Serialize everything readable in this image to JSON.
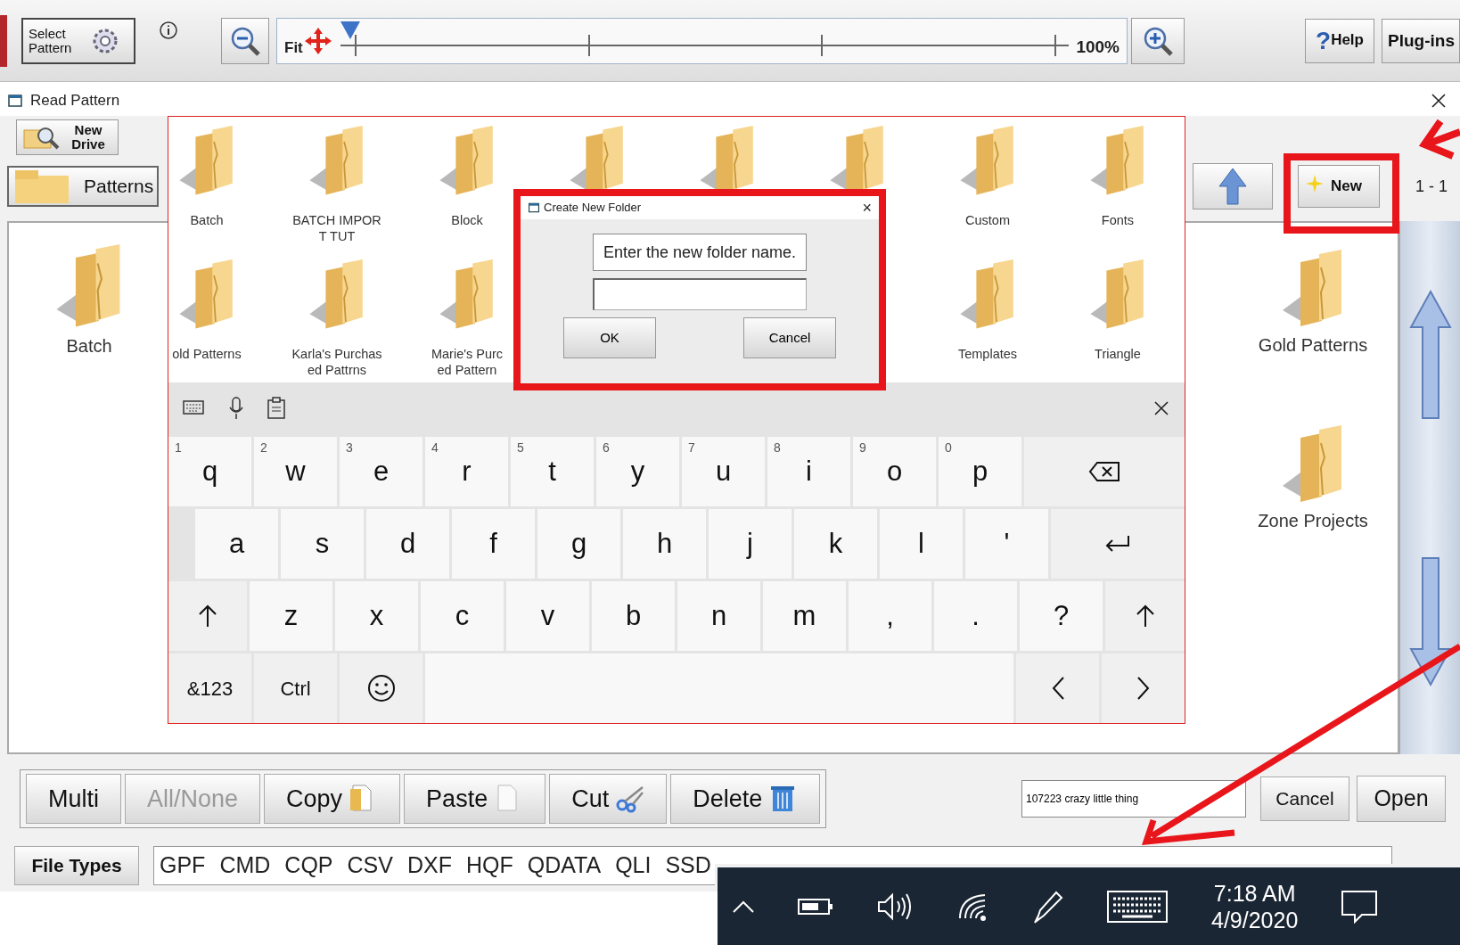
{
  "toolbar": {
    "select_pattern": "Select Pattern",
    "zoom": {
      "fit_label": "Fit",
      "max_label": "100%",
      "level": 0
    },
    "help": {
      "glyph": "?",
      "label": "Help"
    },
    "plugins": "Plug-ins"
  },
  "window": {
    "title": "Read Pattern"
  },
  "drive_button": "New Drive",
  "patterns_button": "Patterns",
  "nav": {
    "new_button": "New",
    "count": "1 - 1"
  },
  "left_folders": [
    {
      "name": "Batch"
    }
  ],
  "right_folders": [
    {
      "name": "Gold Patterns"
    },
    {
      "name": "Zone Projects"
    }
  ],
  "overlay_folders": [
    {
      "kind": "folder",
      "lines": [
        "Batch"
      ]
    },
    {
      "kind": "folder",
      "lines": [
        "BATCH IMPOR",
        "T TUT"
      ]
    },
    {
      "kind": "folder",
      "lines": [
        "Block"
      ]
    },
    {
      "kind": "folder"
    },
    {
      "kind": "folder"
    },
    {
      "kind": "folder"
    },
    {
      "kind": "folder",
      "lines": [
        "Custom"
      ]
    },
    {
      "kind": "folder",
      "lines": [
        "Fonts"
      ]
    },
    {
      "kind": "folder",
      "lines": [
        "old Patterns"
      ]
    },
    {
      "kind": "folder",
      "lines": [
        "Karla's Purchas",
        "ed Pattrns"
      ]
    },
    {
      "kind": "folder",
      "lines": [
        "Marie's Purc",
        "ed Pattern"
      ]
    },
    {
      "kind": "hidden"
    },
    {
      "kind": "hidden"
    },
    {
      "kind": "hidden"
    },
    {
      "kind": "folder",
      "lines": [
        "Templates"
      ]
    },
    {
      "kind": "folder",
      "lines": [
        "Triangle"
      ]
    }
  ],
  "dialog": {
    "title": "Create New Folder",
    "close": "×",
    "message": "Enter the new folder name.",
    "ok": "OK",
    "cancel": "Cancel"
  },
  "keyboard": {
    "rows": [
      [
        {
          "kind": "char",
          "label": "q",
          "hint": "1"
        },
        {
          "kind": "char",
          "label": "w",
          "hint": "2"
        },
        {
          "kind": "char",
          "label": "e",
          "hint": "3"
        },
        {
          "kind": "char",
          "label": "r",
          "hint": "4"
        },
        {
          "kind": "char",
          "label": "t",
          "hint": "5"
        },
        {
          "kind": "char",
          "label": "y",
          "hint": "6"
        },
        {
          "kind": "char",
          "label": "u",
          "hint": "7"
        },
        {
          "kind": "char",
          "label": "i",
          "hint": "8"
        },
        {
          "kind": "char",
          "label": "o",
          "hint": "9"
        },
        {
          "kind": "char",
          "label": "p",
          "hint": "0"
        },
        {
          "kind": "backspace"
        }
      ],
      [
        {
          "kind": "char",
          "label": "a"
        },
        {
          "kind": "char",
          "label": "s"
        },
        {
          "kind": "char",
          "label": "d"
        },
        {
          "kind": "char",
          "label": "f"
        },
        {
          "kind": "char",
          "label": "g"
        },
        {
          "kind": "char",
          "label": "h"
        },
        {
          "kind": "char",
          "label": "j"
        },
        {
          "kind": "char",
          "label": "k"
        },
        {
          "kind": "char",
          "label": "l"
        },
        {
          "kind": "char",
          "label": "'"
        },
        {
          "kind": "enter"
        }
      ],
      [
        {
          "kind": "shift"
        },
        {
          "kind": "char",
          "label": "z"
        },
        {
          "kind": "char",
          "label": "x"
        },
        {
          "kind": "char",
          "label": "c"
        },
        {
          "kind": "char",
          "label": "v"
        },
        {
          "kind": "char",
          "label": "b"
        },
        {
          "kind": "char",
          "label": "n"
        },
        {
          "kind": "char",
          "label": "m"
        },
        {
          "kind": "char",
          "label": ","
        },
        {
          "kind": "char",
          "label": "."
        },
        {
          "kind": "char",
          "label": "?"
        },
        {
          "kind": "shift"
        }
      ],
      [
        {
          "kind": "text",
          "label": "&123"
        },
        {
          "kind": "text",
          "label": "Ctrl"
        },
        {
          "kind": "emoji"
        },
        {
          "kind": "space"
        },
        {
          "kind": "left"
        },
        {
          "kind": "right"
        }
      ]
    ]
  },
  "actions": [
    {
      "label": "Multi",
      "kind": "plain",
      "disabled": false
    },
    {
      "label": "All/None",
      "kind": "plain",
      "disabled": true
    },
    {
      "label": "Copy",
      "kind": "copy",
      "disabled": false
    },
    {
      "label": "Paste",
      "kind": "paste",
      "disabled": false
    },
    {
      "label": "Cut",
      "kind": "cut",
      "disabled": false
    },
    {
      "label": "Delete",
      "kind": "delete",
      "disabled": false
    }
  ],
  "file_name": "107223 crazy little thing",
  "cancel": "Cancel",
  "open": "Open",
  "file_types": {
    "button": "File Types",
    "types": [
      "GPF",
      "CMD",
      "CQP",
      "CSV",
      "DXF",
      "HQF",
      "QDATA",
      "QLI",
      "SSD"
    ]
  },
  "taskbar": {
    "time": "7:18 AM",
    "date": "4/9/2020"
  }
}
